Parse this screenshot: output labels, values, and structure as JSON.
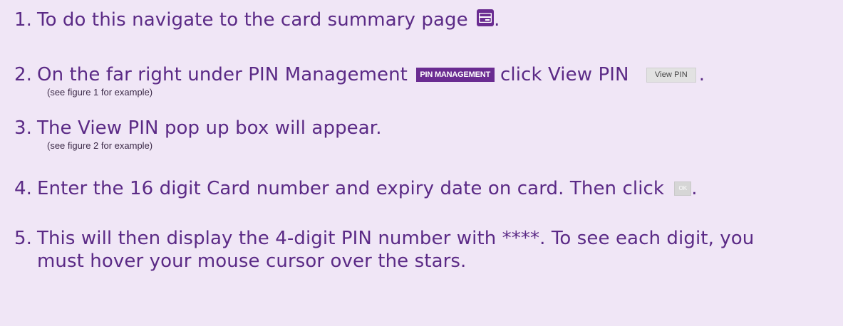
{
  "steps": [
    {
      "number": "1.",
      "text": "To do this navigate to the card summary page",
      "end": "."
    },
    {
      "number": "2.",
      "text_before": "On the far right under PIN Management",
      "pin_management_button": "PIN MANAGEMENT",
      "text_mid": "click View PIN",
      "view_pin_button": "View PIN",
      "end": ".",
      "note": "(see figure 1 for example)"
    },
    {
      "number": "3.",
      "text": "The View PIN pop up box will appear.",
      "note": "(see figure 2 for example)"
    },
    {
      "number": "4.",
      "text": "Enter the 16 digit Card number and expiry date on card. Then click",
      "ok_button": "OK",
      "end": "."
    },
    {
      "number": "5.",
      "text_line1": "This will then display the 4-digit PIN number with ****. To see each digit, you",
      "text_line2": "must hover your mouse cursor over the stars."
    }
  ],
  "colors": {
    "background": "#f0e6f6",
    "text": "#5b2a86",
    "accent": "#6a2c91"
  },
  "icons": {
    "card_summary": "card-icon"
  }
}
